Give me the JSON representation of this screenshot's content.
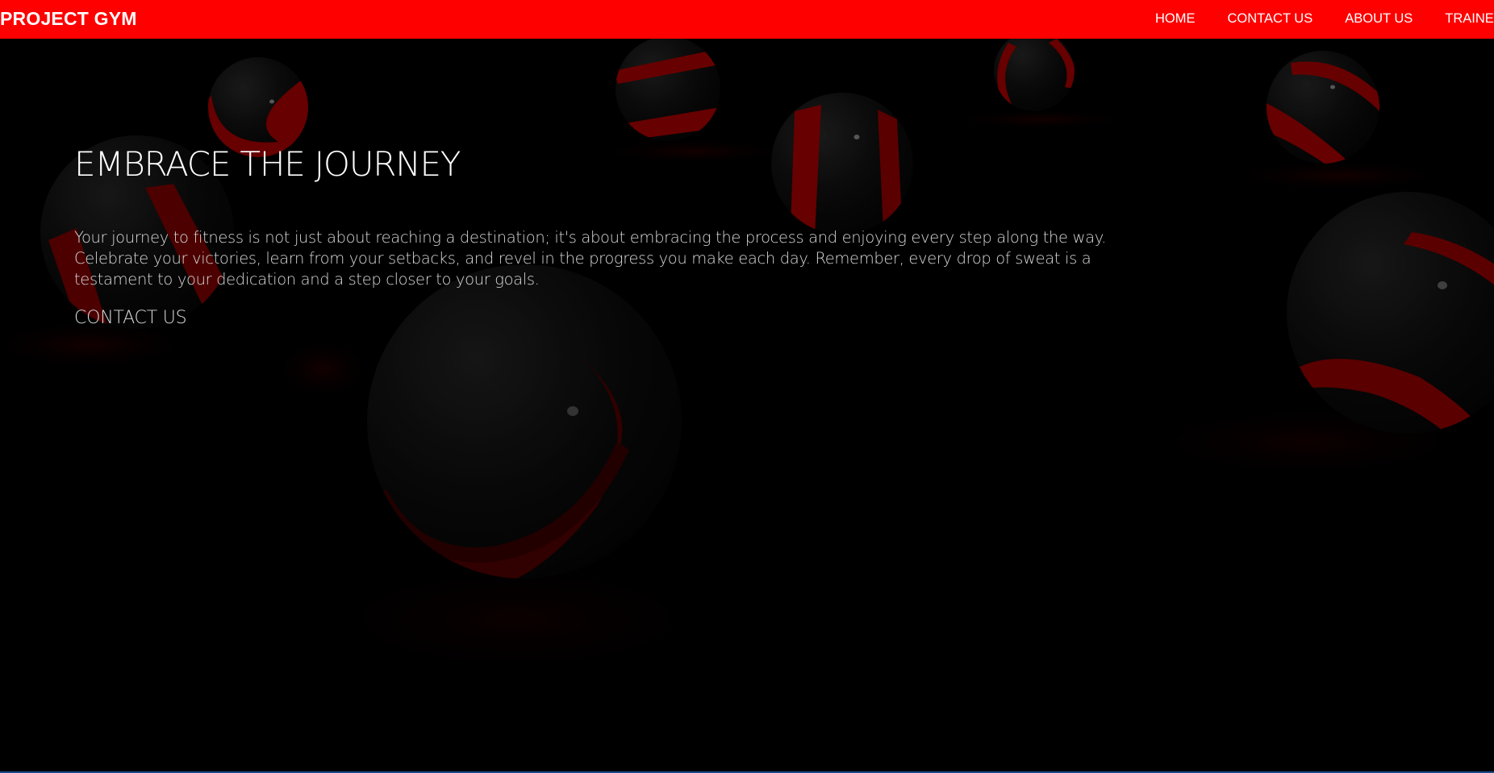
{
  "navbar": {
    "brand": "PROJECT GYM",
    "links": [
      "HOME",
      "CONTACT US",
      "ABOUT US",
      "TRAINER"
    ]
  },
  "hero": {
    "title": "EMBRACE THE JOURNEY",
    "text": "Your journey to fitness is not just about reaching a destination; it's about embracing the process and enjoying every step along the way. Celebrate your victories, learn from your setbacks, and revel in the progress you make each day. Remember, every drop of sweat is a testament to your dedication and a step closer to your goals.",
    "cta": "CONTACT US"
  },
  "colors": {
    "accent": "#ff0000",
    "background": "#000000",
    "text": "#ffffff"
  }
}
